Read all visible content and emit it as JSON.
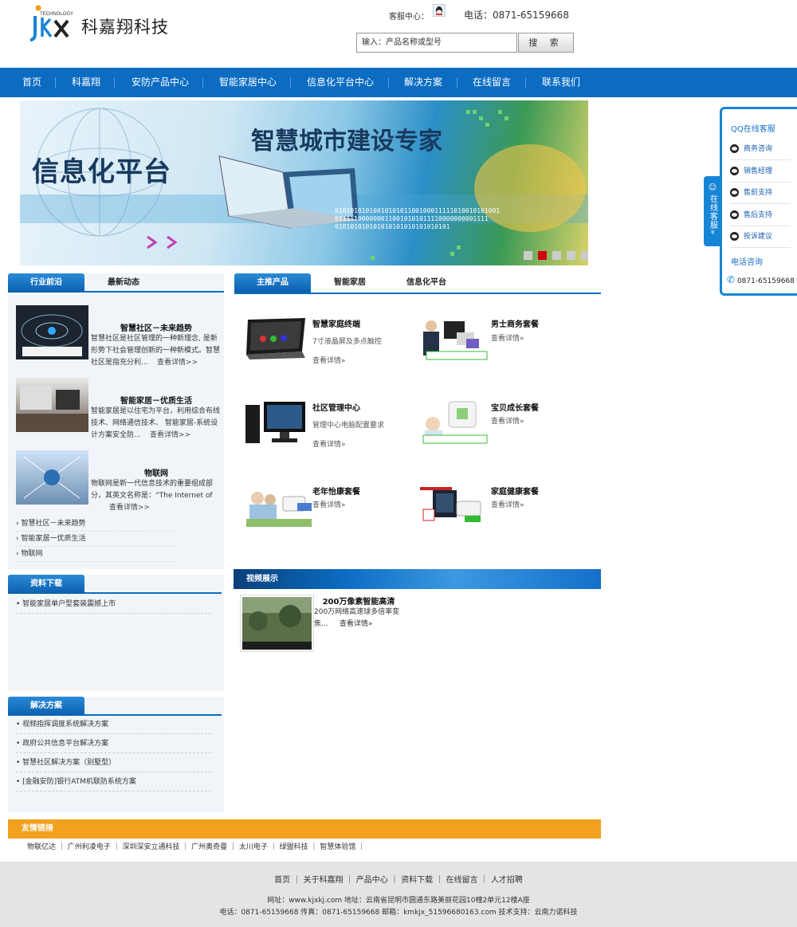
{
  "header": {
    "logo_small": "TECHNOLOGY",
    "logo_letters": "jkx",
    "company_name": "科嘉翔科技",
    "service_label": "客服中心：",
    "phone_label": "电话：0871-65159668",
    "search_placeholder": "输入：产品名称或型号",
    "search_button": "搜 索"
  },
  "nav": [
    "首页",
    "科嘉翔",
    "安防产品中心",
    "智能家居中心",
    "信息化平台中心",
    "解决方案",
    "在线留言",
    "联系我们"
  ],
  "banner": {
    "title_left": "信息化平台",
    "title_right": "智慧城市建设专家",
    "binary_1": "0101010101001010101100100011111010010101001",
    "binary_2": "0111110000000110010101011110000000001111",
    "binary_3": "010101010101010101010101010101"
  },
  "industry": {
    "tab_active": "行业前沿",
    "tab_other": "最新动态",
    "news": [
      {
        "title": "智慧社区－未来趋势",
        "desc": "智慧社区是社区管理的一种新理念, 是新形势下社会管理创新的一种新模式。智慧社区是指充分利...",
        "more": "查看详情>>"
      },
      {
        "title": "智能家居－优质生活",
        "desc": "智能家居是以住宅为平台，利用综合布线技术、网络通信技术、 智能家居-系统设计方案安全防...",
        "more": "查看详情>>"
      },
      {
        "title": "物联网",
        "desc": "物联网是新一代信息技术的重要组成部分，其英文名称是：“The Internet of",
        "more": "查看详情>>"
      }
    ],
    "list": [
      "智慧社区－未来趋势",
      "智能家居一优质生活",
      "物联网"
    ]
  },
  "downloads": {
    "title": "资料下载",
    "items": [
      "智能家居单户型套装震撼上市"
    ]
  },
  "solutions": {
    "title": "解决方案",
    "items": [
      "视频指挥调度系统解决方案",
      "政府公共信息平台解决方案",
      "智慧社区解决方案（别墅型）",
      "[金融安防]银行ATM机联防系统方案"
    ]
  },
  "products": {
    "tab_active": "主推产品",
    "tab_2": "智能家居",
    "tab_3": "信息化平台",
    "items": [
      {
        "name": "智慧家庭终端",
        "desc": "7寸液晶屏及多点触控",
        "more": "查看详情»"
      },
      {
        "name": "男士商务套餐",
        "desc": "",
        "more": "查看详情»",
        "tag": "男士商务套餐"
      },
      {
        "name": "社区管理中心",
        "desc": "管理中心电脑配置要求",
        "more": "查看详情»"
      },
      {
        "name": "宝贝成长套餐",
        "desc": "",
        "more": "查看详情»",
        "tag": "宝贝成长套餐"
      },
      {
        "name": "老年怡康套餐",
        "desc": "",
        "more": "查看详情»",
        "tag": "老年怡康套餐"
      },
      {
        "name": "家庭健康套餐",
        "desc": "",
        "more": "查看详情»"
      }
    ]
  },
  "video": {
    "title": "视频展示",
    "item_title": "200万像素智能高清",
    "item_desc": "200万网络高速球多倍率变焦...",
    "more": "查看详情»"
  },
  "side": {
    "tab": "在线客服»",
    "title": "QQ在线客服",
    "items": [
      "商务咨询",
      "销售经理",
      "售前支持",
      "售后支持",
      "投诉建议"
    ],
    "phone_title": "电话咨询",
    "phone": "0871-65159668"
  },
  "friend": {
    "title": "友情链接",
    "links": "物联亿达 ｜ 广州利凌电子 ｜ 深圳深安立通科技 ｜ 广州奥奇曼 ｜ 太川电子 ｜ 绿盟科技 ｜ 智慧体验馆 ｜"
  },
  "footer": {
    "nav": "首页 ｜ 关于科嘉翔 ｜ 产品中心 ｜ 资料下载 ｜ 在线留言 ｜ 人才招聘",
    "address": "网址：www.kjxkj.com  地址：云南省昆明市圆通东路美丽花园10幢2单元12楼A座",
    "contact": "电话：0871-65159668 传真：0871-65159668 邮箱：kmkjx_51596680163.com 技术支持：云南力诺科技"
  },
  "colors": {
    "primary": "#0b6cc2",
    "accent": "#f1a11e",
    "panel": "#f1f5fa"
  }
}
